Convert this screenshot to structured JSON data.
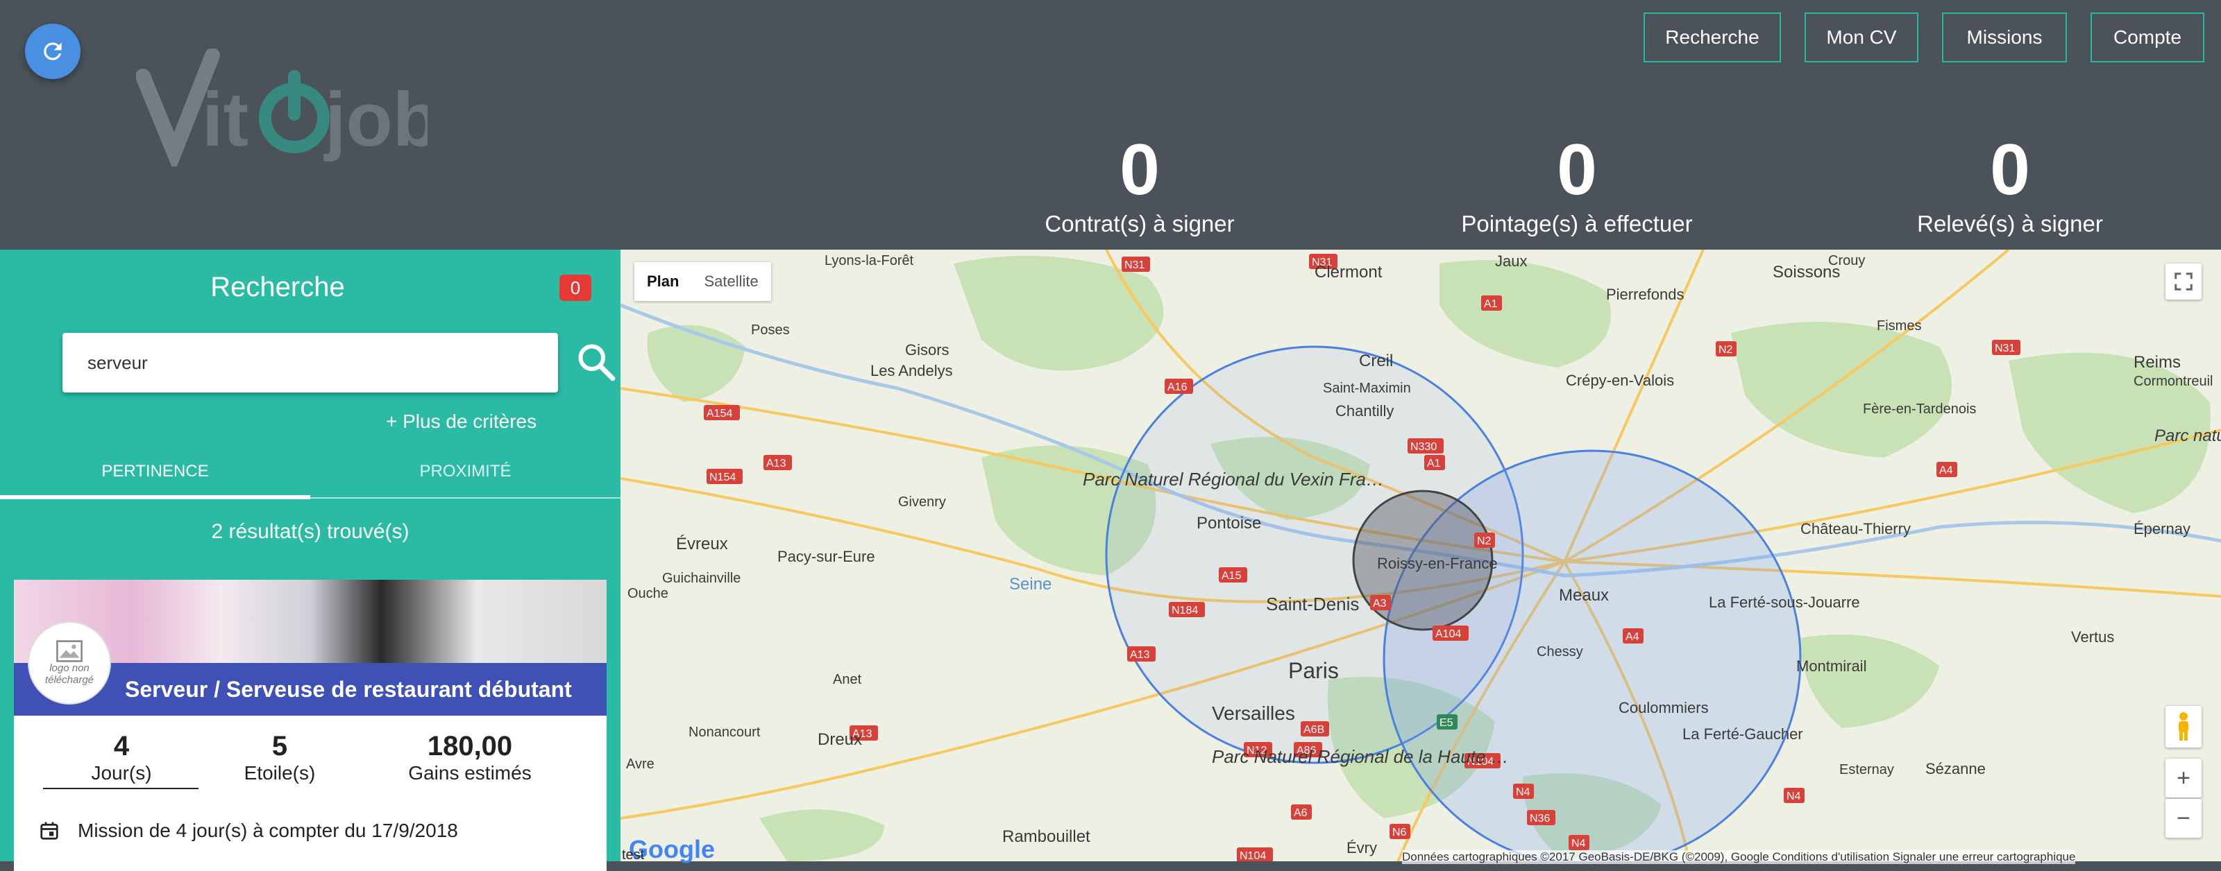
{
  "header": {
    "logo_text": "Vitojob",
    "nav": [
      "Recherche",
      "Mon CV",
      "Missions",
      "Compte"
    ],
    "stats": [
      {
        "value": "0",
        "label": "Contrat(s) à signer"
      },
      {
        "value": "0",
        "label": "Pointage(s) à effectuer"
      },
      {
        "value": "0",
        "label": "Relevé(s) à signer"
      }
    ]
  },
  "sidebar": {
    "title": "Recherche",
    "badge": "0",
    "search_value": "serveur",
    "more_criteria": "+ Plus de critères",
    "tabs": [
      "PERTINENCE",
      "PROXIMITÉ"
    ],
    "results": "2 résultat(s) trouvé(s)"
  },
  "card": {
    "logo_placeholder": "logo non téléchargé",
    "title": "Serveur / Serveuse de restaurant débutant",
    "stats": [
      {
        "value": "4",
        "label": "Jour(s)"
      },
      {
        "value": "5",
        "label": "Etoile(s)"
      },
      {
        "value": "180,00",
        "label": "Gains estimés"
      }
    ],
    "mission": "Mission de 4 jour(s) à compter du 17/9/2018"
  },
  "map": {
    "type_buttons": [
      "Plan",
      "Satellite"
    ],
    "attribution": "Données cartographiques ©2017 GeoBasis-DE/BKG (©2009), Google   Conditions d'utilisation   Signaler une erreur cartographique",
    "google": "Google",
    "test_label": "test",
    "places": [
      "Lyons-la-Forêt",
      "Clermont",
      "Jaux",
      "Pierrefonds",
      "Soissons",
      "Crouy",
      "Fismes",
      "Reims",
      "Cormontreuil",
      "Poses",
      "Gisors",
      "Les Andelys",
      "Creil",
      "Saint-Maximin",
      "Chantilly",
      "Crépy-en-Valois",
      "Fère-en-Tardenois",
      "Parc naturel régional de la Montagne de Reims",
      "Parc Naturel Régional du Vexin Français",
      "Givenry",
      "Pontoise",
      "Château-Thierry",
      "Épernay",
      "Évreux",
      "Pacy-sur-Eure",
      "Guichainville",
      "Ouche",
      "Roissy-en-France",
      "Saint-Denis",
      "Meaux",
      "La Ferté-sous-Jouarre",
      "Paris",
      "Chessy",
      "Montmirail",
      "Vertus",
      "Anet",
      "Versailles",
      "Coulommiers",
      "Nonancourt",
      "Dreux",
      "Parc Naturel Régional de la Haute Vallée de Chevreuse",
      "La Ferté-Gaucher",
      "Esternay",
      "Sézanne",
      "Avre",
      "Rambouillet",
      "Évry",
      "Seine"
    ],
    "roads": [
      "N31",
      "N31",
      "A1",
      "N2",
      "N31",
      "A16",
      "A154",
      "A13",
      "N154",
      "A1",
      "N330",
      "A4",
      "A15",
      "N2",
      "A3",
      "N184",
      "A13",
      "A104",
      "A4",
      "A13",
      "N12",
      "A86",
      "A6B",
      "E5",
      "N104",
      "N4",
      "N4",
      "A6",
      "N36",
      "N6",
      "N104",
      "N4"
    ]
  },
  "colors": {
    "header_bg": "#4b525a",
    "accent": "#2bbba4",
    "card_band": "#3f51b5",
    "badge": "#e53935",
    "refresh": "#4a90e2"
  }
}
